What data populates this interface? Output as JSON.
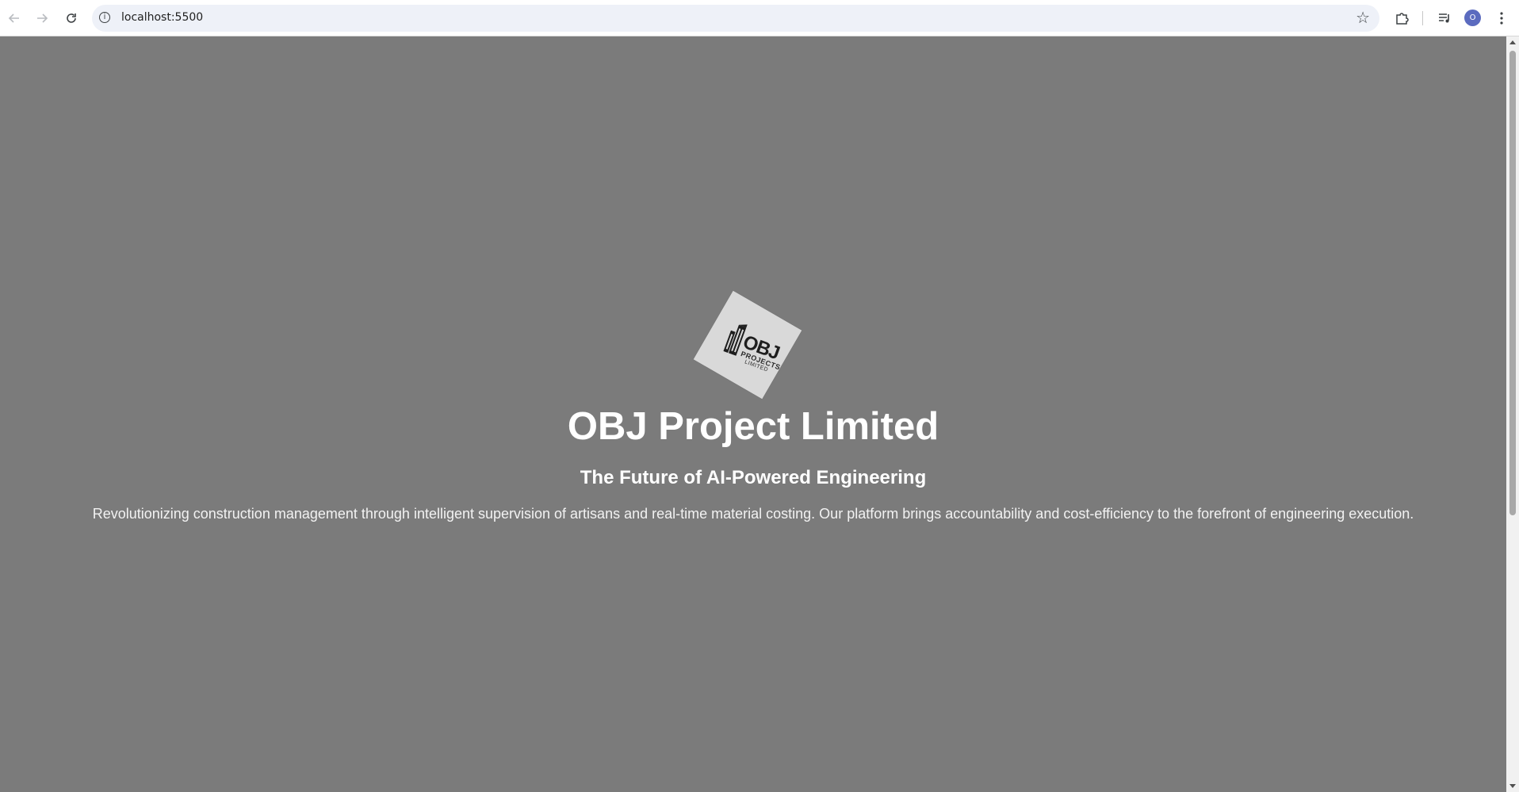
{
  "browser": {
    "url": "localhost:5500",
    "avatar_letter": "O",
    "icons": {
      "back": "arrow-left-icon",
      "forward": "arrow-right-icon",
      "reload": "reload-icon",
      "site_info": "info-icon",
      "bookmark": "star-icon",
      "extensions": "puzzle-icon",
      "media": "media-queue-icon",
      "menu": "kebab-menu-icon"
    }
  },
  "hero": {
    "logo": {
      "main_text": "OBJ",
      "sub_text": "PROJECTS",
      "sub_text2": "LIMITED"
    },
    "title": "OBJ Project Limited",
    "subtitle": "The Future of AI-Powered Engineering",
    "description": "Revolutionizing construction management through intelligent supervision of artisans and real-time material costing. Our platform brings accountability and cost-efficiency to the forefront of engineering execution."
  },
  "colors": {
    "page_background": "#7b7b7b",
    "logo_background": "#d9d9d9",
    "title_color": "#ffffff",
    "avatar_color": "#5b6bbf"
  }
}
